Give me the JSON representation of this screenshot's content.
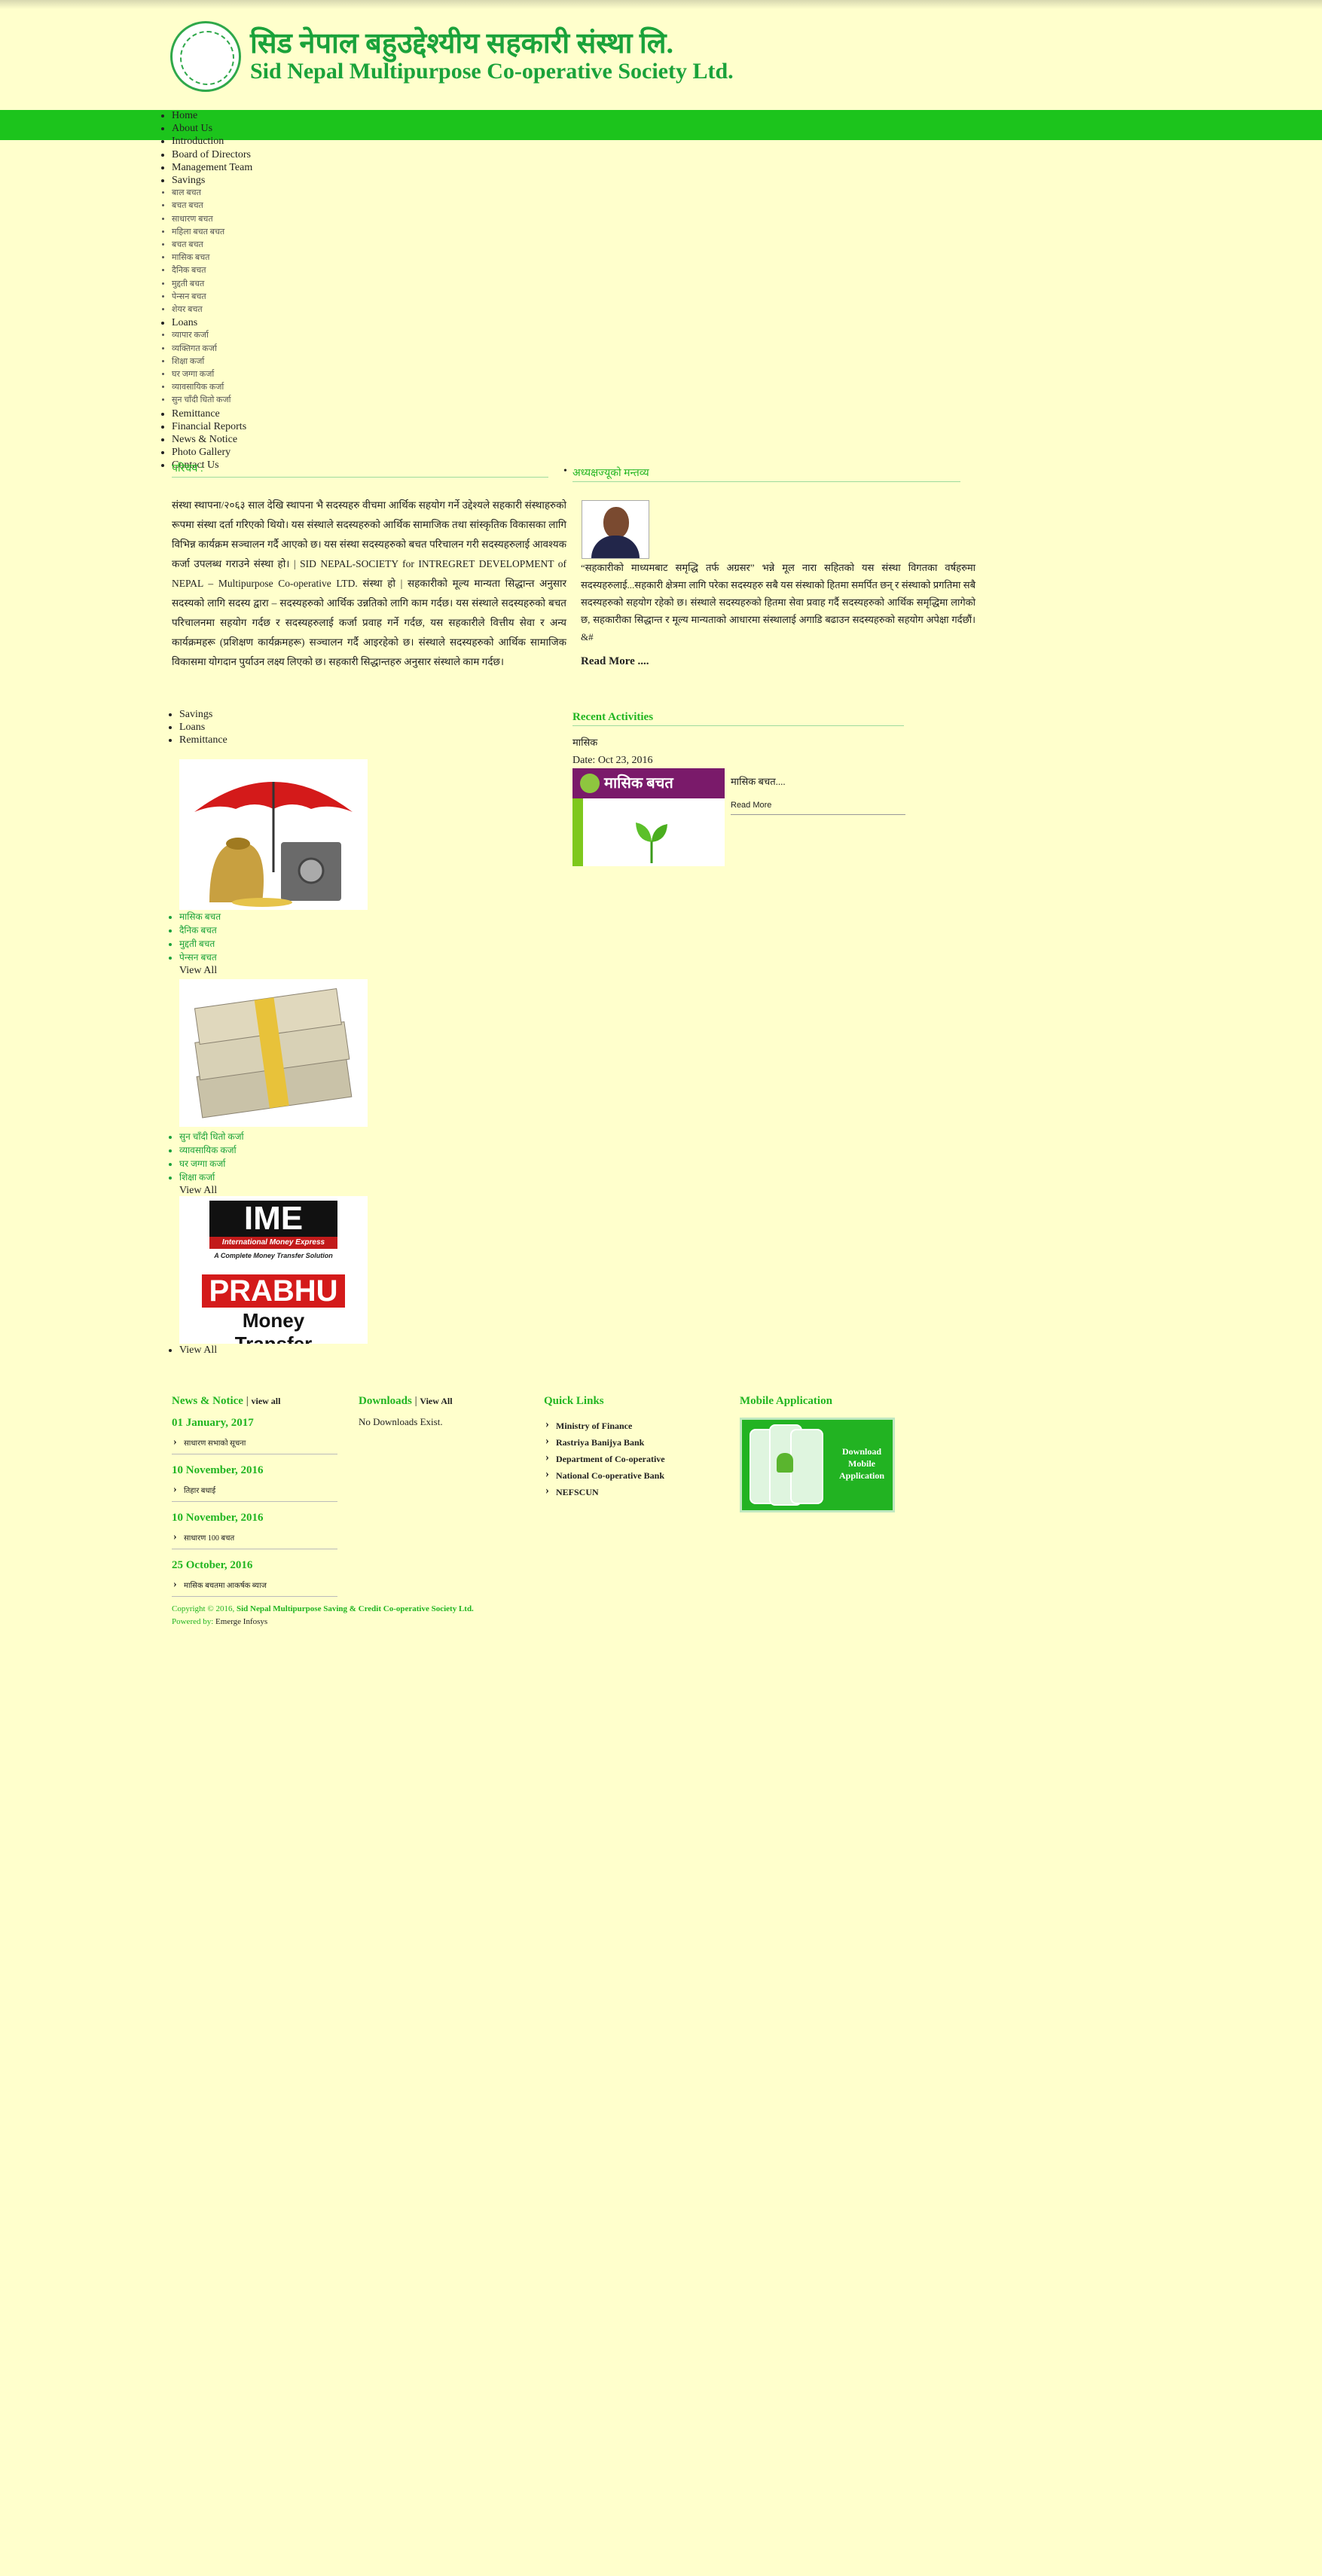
{
  "header": {
    "title_np": "सिड नेपाल बहुउद्देश्यीय सहकारी संस्था लि.",
    "title_en": "Sid Nepal Multipurpose Co-operative Society Ltd."
  },
  "menu": [
    {
      "label": "Home"
    },
    {
      "label": "About Us"
    },
    {
      "label": "Introduction"
    },
    {
      "label": "Board of Directors"
    },
    {
      "label": "Management Team"
    },
    {
      "label": "Savings"
    },
    {
      "label": "बाल बचत"
    },
    {
      "label": "बचत बचत"
    },
    {
      "label": "साधारण बचत"
    },
    {
      "label": "महिला बचत बचत"
    },
    {
      "label": "बचत बचत"
    },
    {
      "label": "मासिक बचत"
    },
    {
      "label": "दैनिक बचत"
    },
    {
      "label": "मुद्दती बचत"
    },
    {
      "label": "पेन्सन बचत"
    },
    {
      "label": "शेयर बचत"
    },
    {
      "label": "Loans"
    },
    {
      "label": "व्यापार कर्जा"
    },
    {
      "label": "व्यक्तिगत कर्जा"
    },
    {
      "label": "शिक्षा कर्जा"
    },
    {
      "label": "घर जग्गा कर्जा"
    },
    {
      "label": "व्यावसायिक कर्जा"
    },
    {
      "label": "सुन चाँदी धितो कर्जा"
    },
    {
      "label": "Remittance"
    },
    {
      "label": "Financial Reports"
    },
    {
      "label": "News & Notice"
    },
    {
      "label": "Photo Gallery"
    },
    {
      "label": "Contact Us"
    }
  ],
  "intro": {
    "title": "परिचय :",
    "text": "संस्था स्थापना/२०६३ साल देखि स्थापना भै सदस्यहरु वीचमा आर्थिक सहयोग गर्ने उद्देश्यले सहकारी संस्थाहरुको रूपमा संस्था दर्ता गरिएको थियो। यस संस्थाले सदस्यहरुको आर्थिक सामाजिक तथा सांस्कृतिक विकासका लागि विभिन्न कार्यक्रम सञ्चालन गर्दै आएको छ। यस संस्था सदस्यहरुको बचत परिचालन गरी सदस्यहरुलाई आवश्यक कर्जा उपलब्ध गराउने संस्था हो। | SID NEPAL-SOCIETY for INTREGRET DEVELOPMENT of NEPAL – Multipurpose Co-operative LTD. संस्था हो | सहकारीको मूल्य मान्यता सिद्धान्त अनुसार सदस्यको लागि सदस्य द्वारा – सदस्यहरुको आर्थिक उन्नतिको लागि काम गर्दछ। यस संस्थाले सदस्यहरुको बचत परिचालनमा सहयोग गर्दछ र सदस्यहरुलाई कर्जा प्रवाह गर्ने गर्दछ, यस सहकारीले वित्तीय सेवा र अन्य कार्यक्रमहरू (प्रशिक्षण कार्यक्रमहरू) सञ्चालन गर्दै आइरहेको छ। संस्थाले सदस्यहरुको आर्थिक सामाजिक विकासमा योगदान पुर्याउन लक्ष्य लिएको छ। सहकारी सिद्धान्तहरु अनुसार संस्थाले काम गर्दछ।"
  },
  "message": {
    "title": "अध्यक्षज्यूको मन्तव्य",
    "text": "“सहकारीको माध्यमबाट समृद्धि तर्फ अग्रसर” भन्ने मूल नारा सहितको यस संस्था विगतका वर्षहरुमा सदस्यहरुलाई...सहकारी क्षेत्रमा लागि परेका सदस्यहरु सबै यस संस्थाको हितमा समर्पित छन् र संस्थाको प्रगतिमा सबै सदस्यहरुको सहयोग रहेको छ। संस्थाले सदस्यहरुको हितमा सेवा प्रवाह गर्दै सदस्यहरुको आर्थिक समृद्धिमा लागेको छ, सहकारीका सिद्धान्त र मूल्य मान्यताको आधारमा संस्थालाई अगाडि बढाउन सदस्यहरुको सहयोग अपेक्षा गर्दछौं। &#",
    "read_more": "Read More ...."
  },
  "services": {
    "tabs": [
      "Savings",
      "Loans",
      "Remittance"
    ],
    "savings": {
      "items": [
        "मासिक बचत",
        "दैनिक बचत",
        "मुद्दती बचत",
        "पेन्सन बचत"
      ],
      "view_all": "View All"
    },
    "loans": {
      "items": [
        "सुन चाँदी धितो कर्जा",
        "व्यावसायिक कर्जा",
        "घर जग्गा कर्जा",
        "शिक्षा कर्जा"
      ],
      "view_all": "View All"
    },
    "remittance": {
      "view_all": "View All",
      "logo1": "IME",
      "logo1_sub": "International Money Express",
      "logo1_tag": "A Complete Money Transfer Solution",
      "logo2": "PRABHU",
      "logo2_sub": "Money Transfer"
    }
  },
  "activities": {
    "title": "Recent Activities",
    "subtitle": "मासिक",
    "date": "Date: Oct 23, 2016",
    "image_text": "मासिक बचत",
    "excerpt": "मासिक बचत....",
    "read_more": "Read More"
  },
  "footer": {
    "news_title": "News & Notice",
    "news_view_all": "view all",
    "news": [
      {
        "date": "01 January, 2017",
        "item": "साधारण सभाको सूचना"
      },
      {
        "date": "10 November, 2016",
        "item": "तिहार बधाई"
      },
      {
        "date": "10 November, 2016",
        "item": "साधारण 100 बचत"
      },
      {
        "date": "25 October, 2016",
        "item": "मासिक बचतमा आकर्षक ब्याज"
      }
    ],
    "downloads_title": "Downloads",
    "downloads_view_all": "View All",
    "downloads_empty": "No Downloads Exist.",
    "quick_title": "Quick Links",
    "quick_links": [
      "Ministry of Finance",
      "Rastriya Banijya Bank",
      "Department of Co-operative",
      "National Co-operative Bank",
      "NEFSCUN"
    ],
    "app_title": "Mobile Application",
    "app_label": "Download Mobile Application",
    "copyright_prefix": "Copyright © 2016,",
    "copyright_org": "Sid Nepal Multipurpose Saving & Credit Co-operative Society Ltd.",
    "powered_label": "Powered by:",
    "powered_by": "Emerge Infosys"
  },
  "colors": {
    "bg": "#ffffcc",
    "green": "#21b521",
    "navbar": "#1cc41c"
  }
}
